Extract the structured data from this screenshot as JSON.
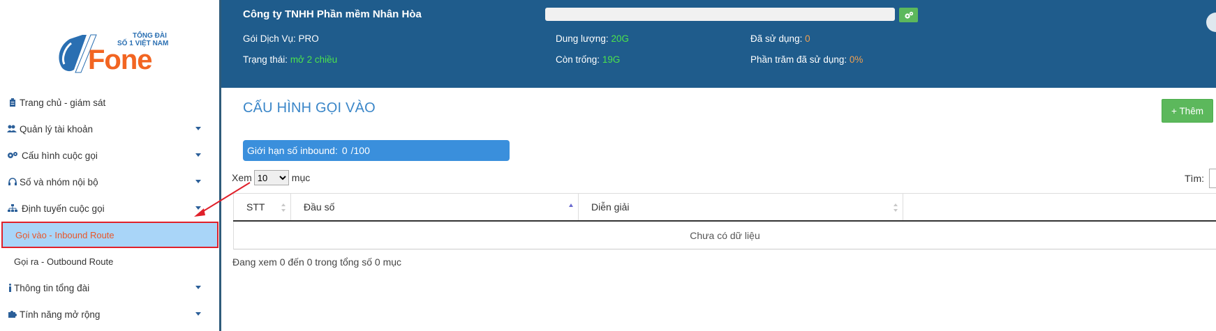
{
  "logo": {
    "tagline_line1": "TỔNG ĐÀI",
    "tagline_line2": "SỐ 1 VIỆT NAM",
    "brand": "Fone"
  },
  "sidebar": {
    "items": [
      {
        "label": "Trang chủ - giám sát",
        "icon": "clipboard-icon",
        "has_caret": false
      },
      {
        "label": "Quản lý tài khoản",
        "icon": "users-icon",
        "has_caret": true
      },
      {
        "label": "Cấu hình cuộc gọi",
        "icon": "gears-icon",
        "has_caret": true
      },
      {
        "label": "Số và nhóm nội bộ",
        "icon": "headset-icon",
        "has_caret": true
      },
      {
        "label": "Định tuyến cuộc gọi",
        "icon": "sitemap-icon",
        "has_caret": true
      },
      {
        "label": "Gọi vào - Inbound Route",
        "active": true
      },
      {
        "label": "Gọi ra - Outbound Route"
      },
      {
        "label": "Thông tin tổng đài",
        "icon": "info-icon",
        "has_caret": true
      },
      {
        "label": "Tính năng mở rộng",
        "icon": "puzzle-icon",
        "has_caret": true
      }
    ]
  },
  "header": {
    "company": "Công ty TNHH Phần mềm Nhân Hòa",
    "service_label": "Gói Dịch Vụ:",
    "service_value": "PRO",
    "status_label": "Trạng thái:",
    "status_value": "mở 2 chiều",
    "capacity_label": "Dung lượng:",
    "capacity_value": "20G",
    "free_label": "Còn trống:",
    "free_value": "19G",
    "used_label": "Đã sử dụng:",
    "used_value": "0",
    "percent_label": "Phần trăm đã sử dụng:",
    "percent_value": "0%"
  },
  "main": {
    "title": "CẤU HÌNH GỌI VÀO",
    "add_button": "+ Thêm",
    "limit_label": "Giới hạn số inbound:",
    "limit_value": "0",
    "limit_max": "/100",
    "show_label": "Xem",
    "show_value": "10",
    "show_suffix": "mục",
    "search_label": "Tìm:",
    "columns": [
      "STT",
      "Đầu số",
      "Diễn giải"
    ],
    "empty_text": "Chưa có dữ liệu",
    "footer": "Đang xem 0 đến 0 trong tổng số 0 mục"
  },
  "colors": {
    "header_bg": "#1f5c8c",
    "accent_green": "#5cb85c",
    "title_blue": "#3a86c8",
    "active_bg": "#a9d5f8",
    "active_text": "#e8562a",
    "annotation_red": "#e0202a"
  }
}
